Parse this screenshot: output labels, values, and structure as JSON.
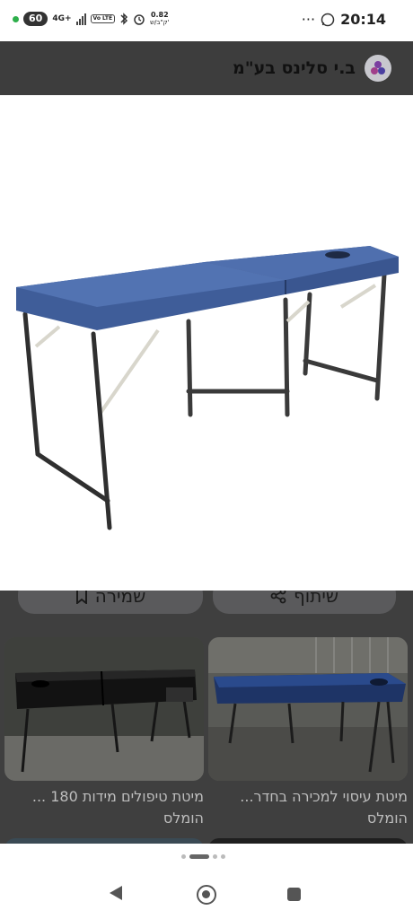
{
  "status_bar": {
    "battery": "60",
    "network": "4G+",
    "volte": "Vo LTE",
    "speed_value": "0.82",
    "speed_unit": "ק\"ב/ש'",
    "more": "···",
    "time": "20:14",
    "icons": [
      "whatsapp-icon",
      "bluetooth-icon",
      "alarm-icon",
      "signal-icon"
    ]
  },
  "header": {
    "site_name": "ב.י סלינס בע\"מ"
  },
  "main_image": {
    "description_icon": "massage-table-image",
    "colors": {
      "pad": "#3c5a96",
      "frame": "#3a3a3a"
    }
  },
  "actions": {
    "save_label": "שמירה",
    "share_label": "שיתוף"
  },
  "related": [
    {
      "caption": "מיטת עיסוי למכירה בחדר... הומלס"
    },
    {
      "caption": "מיטת טיפולים מידות 180 ... הומלס"
    }
  ],
  "colors": {
    "overlay": "#3f3f3f",
    "button": "#5a5a5c",
    "caption": "#bdbdbd"
  }
}
